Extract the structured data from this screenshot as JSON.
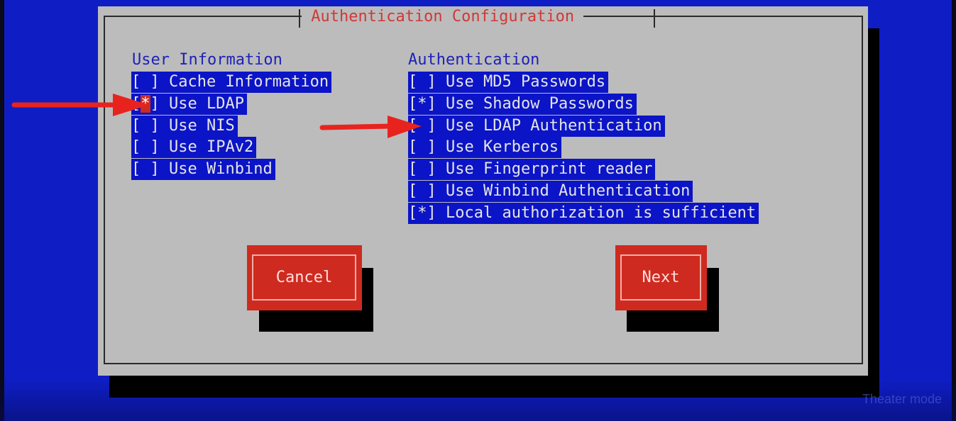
{
  "dialog": {
    "title": " Authentication Configuration "
  },
  "user_information": {
    "heading": "User Information",
    "items": [
      {
        "box": "[ ]",
        "label": "Cache Information",
        "checked": false
      },
      {
        "box": "[*]",
        "label": "Use LDAP",
        "checked": true,
        "focused": true
      },
      {
        "box": "[ ]",
        "label": "Use NIS",
        "checked": false
      },
      {
        "box": "[ ]",
        "label": "Use IPAv2",
        "checked": false
      },
      {
        "box": "[ ]",
        "label": "Use Winbind",
        "checked": false
      }
    ]
  },
  "authentication": {
    "heading": "Authentication",
    "items": [
      {
        "box": "[ ]",
        "label": "Use MD5 Passwords",
        "checked": false
      },
      {
        "box": "[*]",
        "label": "Use Shadow Passwords",
        "checked": true
      },
      {
        "box": "[ ]",
        "label": "Use LDAP Authentication",
        "checked": false
      },
      {
        "box": "[ ]",
        "label": "Use Kerberos",
        "checked": false
      },
      {
        "box": "[ ]",
        "label": "Use Fingerprint reader",
        "checked": false
      },
      {
        "box": "[ ]",
        "label": "Use Winbind Authentication",
        "checked": false
      },
      {
        "box": "[*]",
        "label": "Local authorization is sufficient",
        "checked": true
      }
    ]
  },
  "buttons": {
    "cancel": "Cancel",
    "next": "Next"
  },
  "player_overlay": {
    "hint": "Theater mode"
  },
  "colors": {
    "screen_blue": "#0f1ec4",
    "dialog_gray": "#bcbcbc",
    "title_red": "#d03838",
    "button_red": "#cf2a1f",
    "highlight_blue": "#0b14c6",
    "annotation_arrow": "#e8231e"
  },
  "annotations": [
    {
      "icon": "red-arrow-icon",
      "points_to": "Use LDAP"
    },
    {
      "icon": "red-arrow-icon",
      "points_to": "Use LDAP Authentication"
    }
  ]
}
